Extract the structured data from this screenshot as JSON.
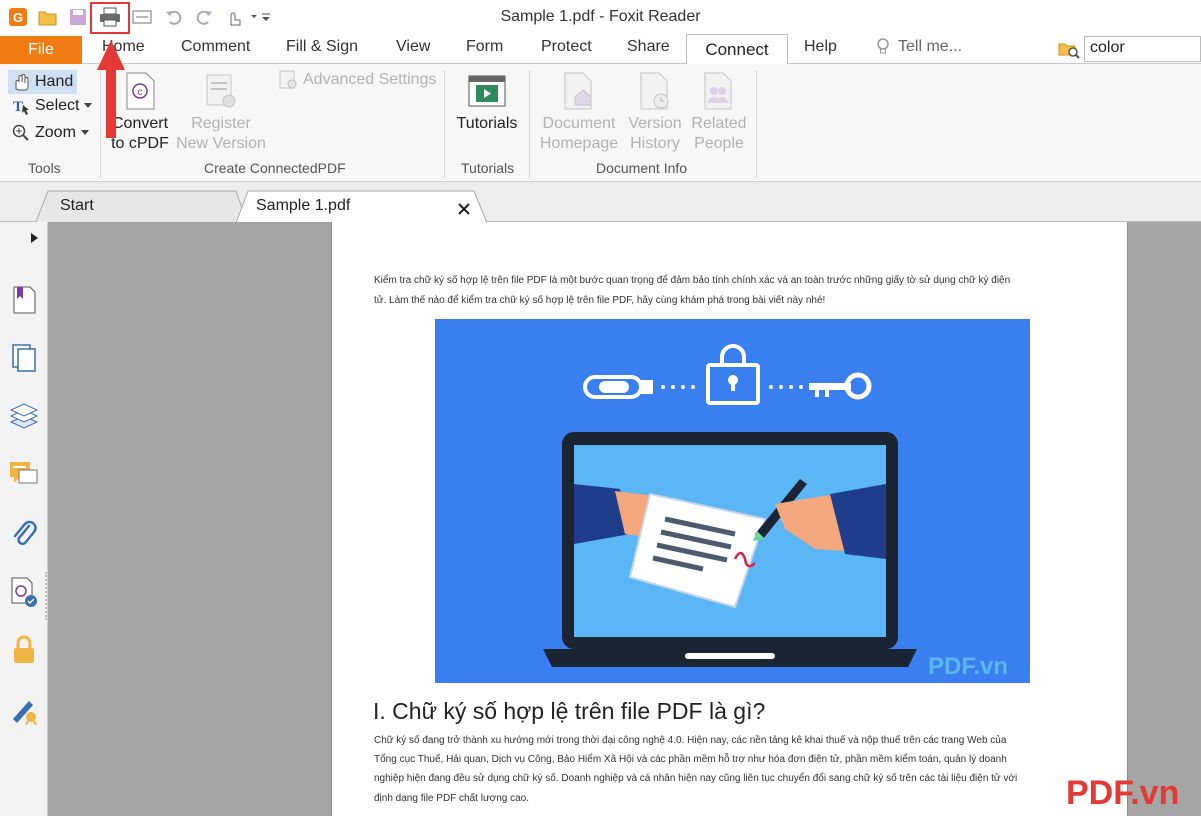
{
  "window": {
    "title": "Sample 1.pdf - Foxit Reader"
  },
  "menu": {
    "file": "File",
    "tabs": [
      "Home",
      "Comment",
      "Fill & Sign",
      "View",
      "Form",
      "Protect",
      "Share"
    ],
    "active_tab": "Connect",
    "help": "Help",
    "tell_me": "Tell me...",
    "search_value": "color"
  },
  "ribbon": {
    "tools": {
      "hand": "Hand",
      "select": "Select",
      "zoom": "Zoom",
      "group_label": "Tools"
    },
    "create": {
      "convert": [
        "Convert",
        "to cPDF"
      ],
      "register": [
        "Register",
        "New Version"
      ],
      "advanced": "Advanced Settings",
      "group_label": "Create ConnectedPDF"
    },
    "tutorials": {
      "button": "Tutorials",
      "group_label": "Tutorials"
    },
    "docinfo": {
      "homepage": [
        "Document",
        "Homepage"
      ],
      "history": [
        "Version",
        "History"
      ],
      "people": [
        "Related",
        "People"
      ],
      "group_label": "Document Info"
    }
  },
  "doc_tabs": {
    "start": "Start",
    "current": "Sample 1.pdf"
  },
  "document": {
    "intro_line1": "Kiểm tra chữ ký số hợp lệ trên file PDF là một bước quan trọng để đảm bảo tính chính xác và an toàn trước những giấy tờ sử dụng chữ ký điện",
    "intro_line2": "tử. Làm thế nào để kiểm tra chữ ký số hợp lệ trên file PDF, hãy cùng khám phá trong bài viết này nhé!",
    "image_watermark": "PDF.vn",
    "heading": "I. Chữ ký số hợp lệ trên file PDF là gì?",
    "body_line1": "Chữ ký số đang trở thành xu hướng mới trong thời đại công nghệ 4.0. Hiện nay, các nền tảng kê khai thuế và nộp thuế trên các trang Web của",
    "body_line2": "Tổng cục Thuế, Hải quan, Dịch vụ Công, Bảo Hiểm Xã Hội và các phần mềm hỗ trợ như hóa đơn điện tử, phần mềm kiểm toán, quản lý doanh",
    "body_line3": "nghiệp hiện đang đều sử dụng chữ ký số. Doanh nghiệp và cá nhân hiện nay cũng liên tục chuyển đổi sang chữ ký số trên các tài liệu điện tử với",
    "body_line4": "định dạng file PDF chất lượng cao."
  },
  "watermark": "PDF.vn",
  "colors": {
    "accent_file": "#f07b10",
    "highlight": "#e53935",
    "image_bg": "#3a7ff0"
  }
}
